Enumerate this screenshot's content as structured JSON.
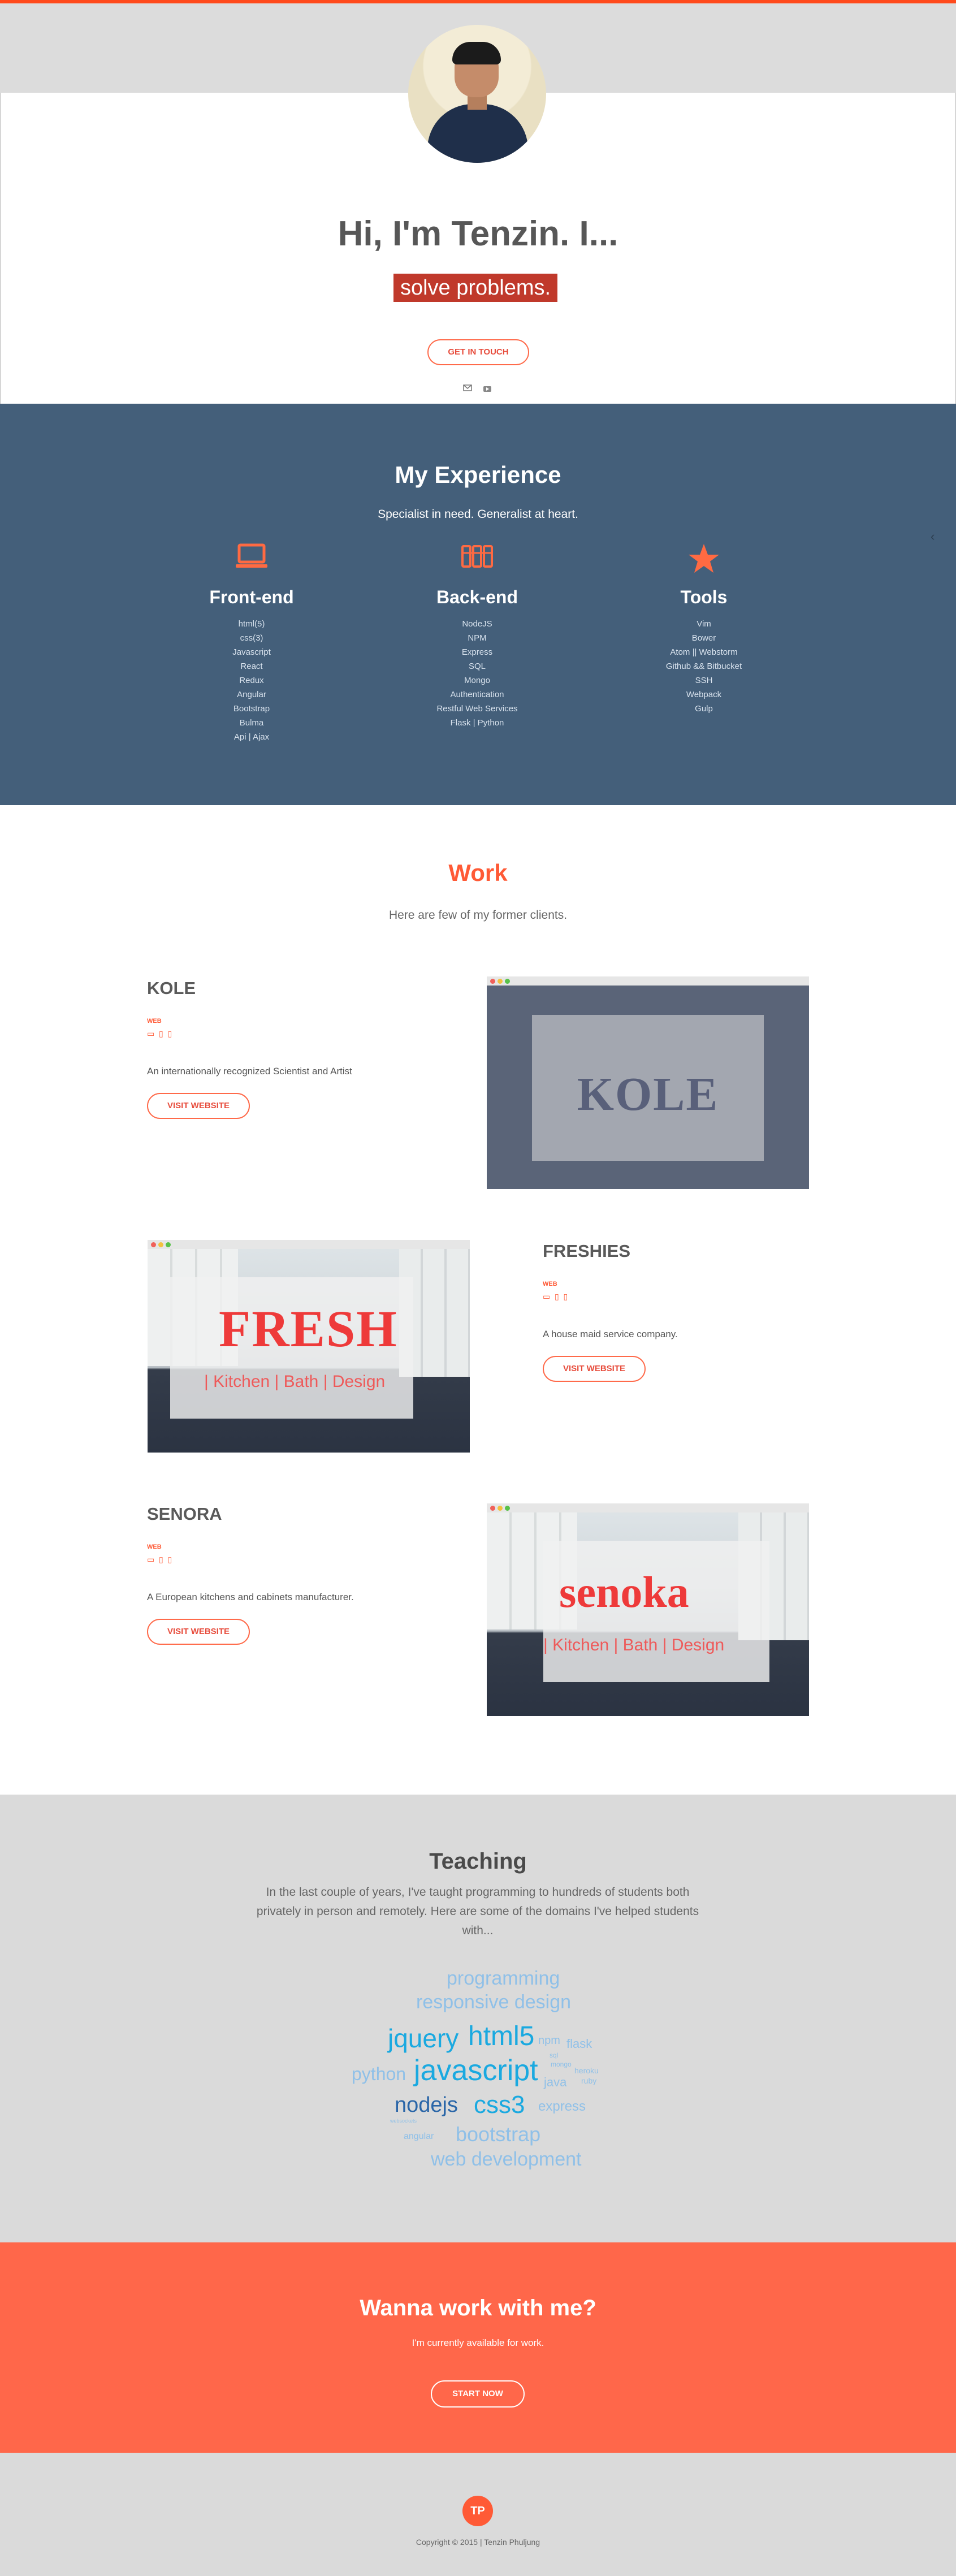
{
  "hero": {
    "title": "Hi, I'm Tenzin. I...",
    "typed_text": "solve problems.",
    "cta_label": "GET IN TOUCH",
    "social": [
      "email-icon",
      "youtube-icon"
    ]
  },
  "experience": {
    "title": "My Experience",
    "subtitle": "Specialist in need. Generalist at heart.",
    "columns": [
      {
        "icon": "laptop-icon",
        "title": "Front-end",
        "items": [
          "html(5)",
          "css(3)",
          "Javascript",
          "React",
          "Redux",
          "Angular",
          "Bootstrap",
          "Bulma",
          "Api | Ajax"
        ]
      },
      {
        "icon": "server-icon",
        "title": "Back-end",
        "items": [
          "NodeJS",
          "NPM",
          "Express",
          "SQL",
          "Mongo",
          "Authentication",
          "Restful Web Services",
          "Flask | Python"
        ]
      },
      {
        "icon": "star-icon",
        "title": "Tools",
        "items": [
          "Vim",
          "Bower",
          "Atom || Webstorm",
          "Github && Bitbucket",
          "SSH",
          "Webpack",
          "Gulp"
        ]
      }
    ]
  },
  "work": {
    "title": "Work",
    "subtitle": "Here are few of my former clients.",
    "projects": [
      {
        "name": "KOLE",
        "tag": "WEB",
        "description": "An internationally recognized Scientist and Artist",
        "button": "VISIT WEBSITE",
        "shot_text": "KOLE"
      },
      {
        "name": "FRESHIES",
        "tag": "WEB",
        "description": "A house maid service company.",
        "button": "VISIT WEBSITE",
        "shot_text": "FRESH",
        "shot_sub": "| Kitchen | Bath | Design"
      },
      {
        "name": "SENORA",
        "tag": "WEB",
        "description": "A European kitchens and cabinets manufacturer.",
        "button": "VISIT WEBSITE",
        "shot_text": "senoka",
        "shot_sub": "| Kitchen | Bath | Design"
      }
    ]
  },
  "teaching": {
    "title": "Teaching",
    "paragraph": "In the last couple of years, I've taught programming to hundreds of students both privately in person and remotely. Here are some of the domains I've helped students with...",
    "words": [
      "programming",
      "responsive design",
      "jquery",
      "html5",
      "npm",
      "flask",
      "java",
      "python",
      "javascript",
      "nodejs",
      "css3",
      "express",
      "bootstrap",
      "web development",
      "sql",
      "mongo",
      "heroku",
      "ruby",
      "websockets",
      "angular"
    ]
  },
  "cta": {
    "title": "Wanna work with me?",
    "subtitle": "I'm currently available for work.",
    "button": "START NOW"
  },
  "footer": {
    "logo": "TP",
    "copyright": "Copyright © 2015 | Tenzin Phuljung"
  },
  "colors": {
    "accent": "#ff5a36",
    "experience_bg": "#445f7a",
    "cta_bg": "#ff674a",
    "gray_bg": "#dadada"
  }
}
